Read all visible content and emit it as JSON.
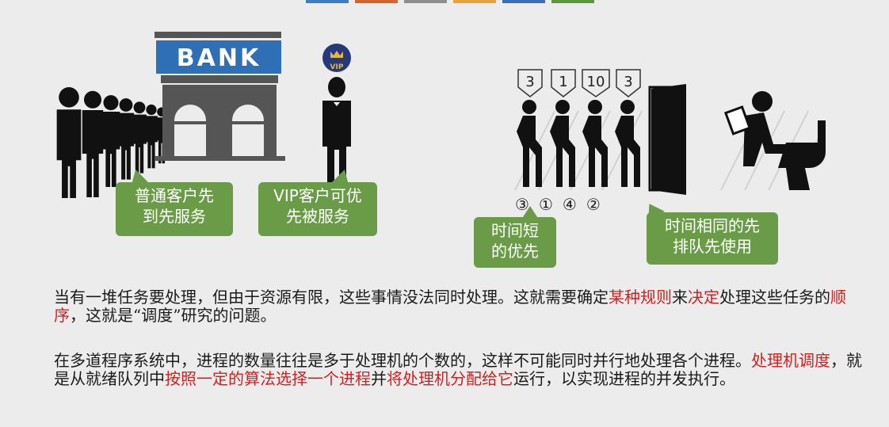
{
  "top_bar_colors": [
    "#3b7dc4",
    "#d9622b",
    "#8e8e8e",
    "#e8a33a",
    "#3a6cc0",
    "#5a9a3a"
  ],
  "bank_scene": {
    "bank_sign": "BANK",
    "vip_badge": "VIP",
    "bubble_left_line1": "普通客户先",
    "bubble_left_line2": "到先服务",
    "bubble_right_line1": "VIP客户可优",
    "bubble_right_line2": "先被服务"
  },
  "toilet_scene": {
    "times": [
      "3",
      "1",
      "10",
      "3"
    ],
    "order_marks": [
      "③",
      "①",
      "④",
      "②"
    ],
    "bubble_short_line1": "时间短",
    "bubble_short_line2": "的优先",
    "bubble_same_line1": "时间相同的先",
    "bubble_same_line2": "排队先使用"
  },
  "paragraph1": {
    "part1": "当有一堆任务要处理，但由于资源有限，这些事情没法同时处理。这就需要确定",
    "red1": "某种规则",
    "part2": "来",
    "red2": "决定",
    "part3": "处理这些任务的",
    "red3": "顺序",
    "part4": "，这就是“调度”研究的问题。"
  },
  "paragraph2": {
    "part1": "在多道程序系统中，进程的数量往往是多于处理机的个数的，这样不可能同时并行地处理各个进程。",
    "red1": "处理机调度",
    "part2": "，就是从就绪队列中",
    "red2": "按照一定的算法选择一个进程",
    "part3": "并",
    "red3": "将处理机分配给它",
    "part4": "运行，以实现进程的并发执行。"
  }
}
